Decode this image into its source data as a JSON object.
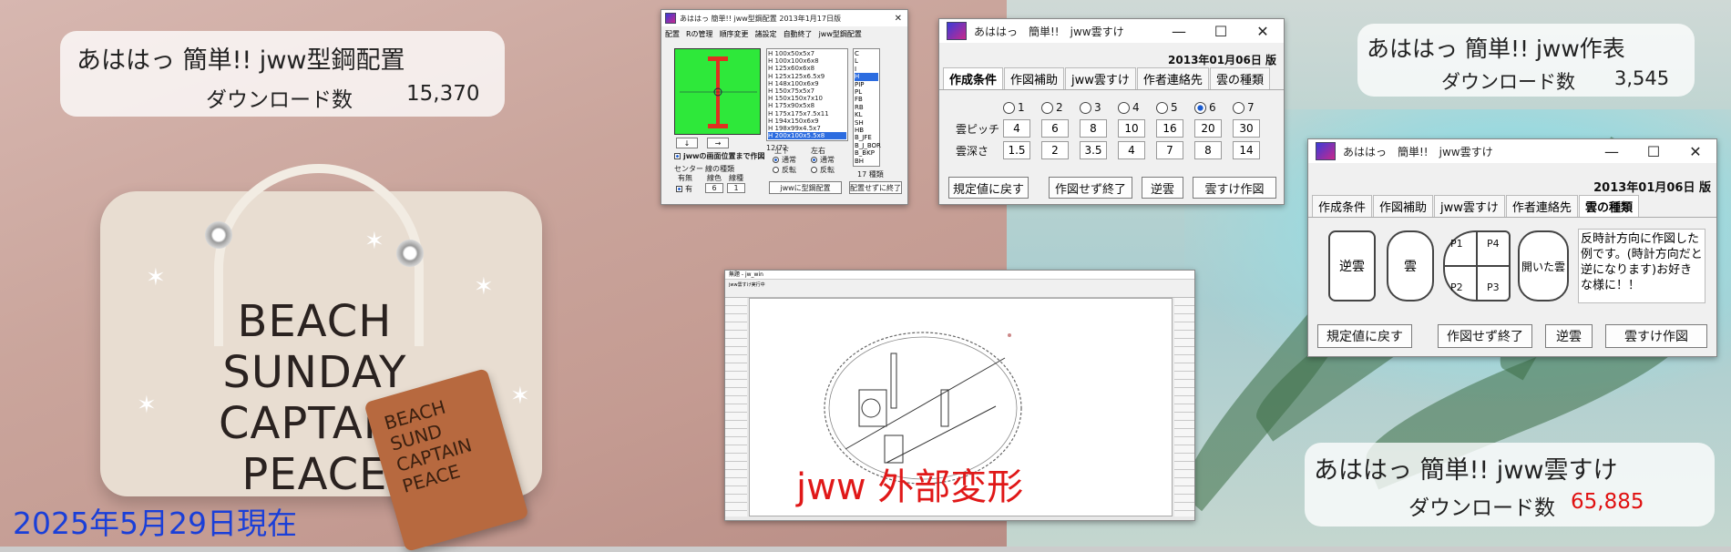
{
  "banner": {
    "date_stamp": "2025年5月29日現在",
    "overlay_text": "jww 外部変形"
  },
  "cards": [
    {
      "title": "あははっ 簡単!! jww型鋼配置",
      "sub_label": "ダウンロード数",
      "count": "15,370"
    },
    {
      "title": "あははっ 簡単!! jww作表",
      "sub_label": "ダウンロード数",
      "count": "3,545"
    },
    {
      "title": "あははっ 簡単!! jww雲すけ",
      "sub_label": "ダウンロード数",
      "count": "65,885"
    }
  ],
  "photo": {
    "bag_text": "BEACH\nSUNDAY\nCAPTAIN\nPEACE",
    "phone_text": "BEACH\nSUND\nCAPTAIN\nPEACE"
  },
  "steel_window": {
    "title": "あははっ 簡単!! jww型鋼配置 2013年1月17日版",
    "tabs": [
      "配置",
      "Rの管理",
      "順序変更",
      "諸設定",
      "自動終了",
      "jww型鋼配置"
    ],
    "sizes": [
      "H 100x50x5x7",
      "H 100x100x6x8",
      "H 125x60x6x8",
      "H 125x125x6.5x9",
      "H 148x100x6x9",
      "H 150x75x5x7",
      "H 150x150x7x10",
      "H 175x90x5x8",
      "H 175x175x7.5x11",
      "H 194x150x6x9",
      "H 198x99x4.5x7",
      "H 200x100x5.5x8"
    ],
    "types": [
      "C",
      "L",
      "I",
      "H",
      "PIP",
      "PL",
      "FB",
      "RB",
      "KL",
      "SH",
      "HB",
      "B_JFE",
      "B_J_BOR",
      "B_BKP",
      "BH"
    ],
    "count_label": "12/72",
    "type_count": "17 種類",
    "checkbox_label": "jwwの画面位置まで作図",
    "updown_label": "上下",
    "lr_label": "左右",
    "normal": "通常",
    "reverse": "反転",
    "center_label": "センター",
    "line_type_label": "線の種類",
    "exist_label": "有無",
    "color_label": "線色",
    "linetype2_label": "線種",
    "on_label": "有",
    "color_val": "6",
    "line_val": "1",
    "place_btn": "jwwに型鋼配置",
    "quit_btn": "配置せずに終了"
  },
  "cloud_window_1": {
    "title": "あははっ　簡単!!　jww雲すけ",
    "version": "2013年01月06日 版",
    "tabs": [
      "作成条件",
      "作図補助",
      "jww雲すけ",
      "作者連絡先",
      "雲の種類"
    ],
    "radios": [
      "1",
      "2",
      "3",
      "4",
      "5",
      "6",
      "7"
    ],
    "selected": "6",
    "pitch_label": "雲ピッチ",
    "pitch": [
      "4",
      "6",
      "8",
      "10",
      "16",
      "20",
      "30"
    ],
    "depth_label": "雲深さ",
    "depth": [
      "1.5",
      "2",
      "3.5",
      "4",
      "7",
      "8",
      "14"
    ],
    "buttons": [
      "規定値に戻す",
      "作図せず終了",
      "逆雲",
      "雲すけ作図"
    ]
  },
  "cloud_window_2": {
    "title": "あははっ　簡単!!　jww雲すけ",
    "version": "2013年01月06日 版",
    "tabs": [
      "作成条件",
      "作図補助",
      "jww雲すけ",
      "作者連絡先",
      "雲の種類"
    ],
    "shapes": [
      "逆雲",
      "雲",
      "P1",
      "P4",
      "P2",
      "P3",
      "開いた雲"
    ],
    "note": "反時計方向に作図した例です。(時計方向だと逆になります)お好きな様に！！",
    "buttons": [
      "規定値に戻す",
      "作図せず終了",
      "逆雲",
      "雲すけ作図"
    ]
  },
  "cad_window": {
    "title": "無題 - jw_win",
    "status": "jww雲すけ実行中"
  }
}
